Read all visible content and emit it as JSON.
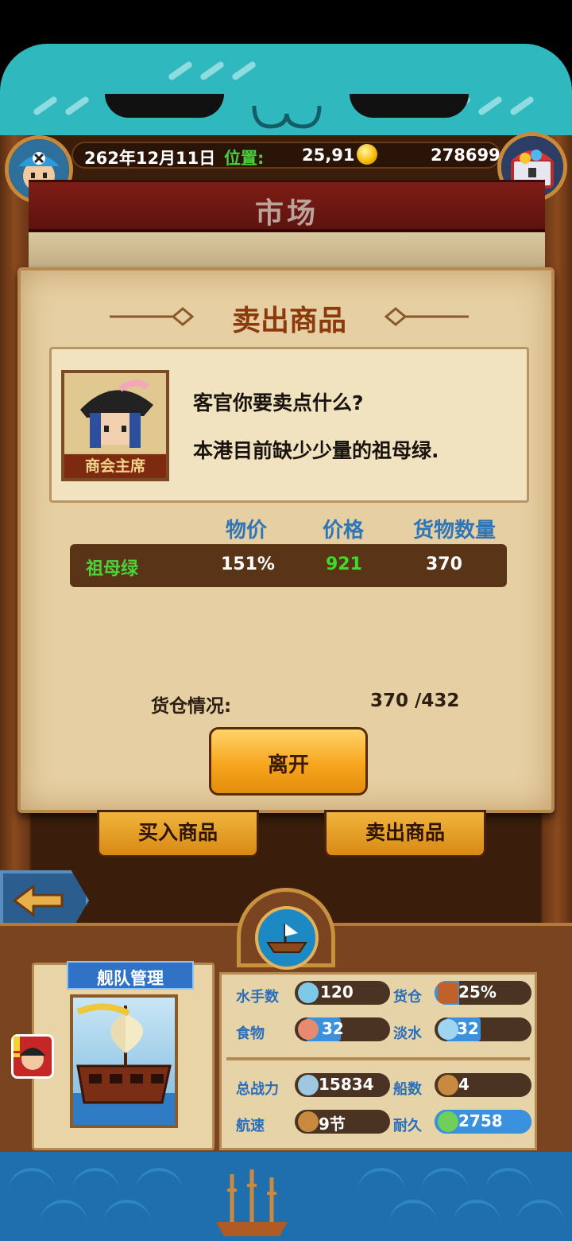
{
  "status": {
    "date": "262年12月11日",
    "position_label": "位置:",
    "position_value": "25,91",
    "gold": "278699"
  },
  "market": {
    "title": "市场"
  },
  "sell_panel": {
    "title": "卖出商品",
    "npc_label": "商会主席",
    "dialog_line1": "客官你要卖点什么?",
    "dialog_line2": "本港目前缺少少量的祖母绿.",
    "columns": [
      "物价",
      "价格",
      "货物数量"
    ],
    "goods": [
      {
        "name": "祖母绿",
        "price_index": "151%",
        "price": "921",
        "quantity": "370"
      }
    ],
    "hold_label": "货仓情况:",
    "hold_value": "370 /432",
    "leave_label": "离开"
  },
  "bottom_buttons": {
    "buy": "买入商品",
    "sell": "卖出商品"
  },
  "fleet": {
    "title": "舰队管理",
    "stats": [
      {
        "label": "水手数",
        "value": "120",
        "icon": "sailor-icon"
      },
      {
        "label": "货仓",
        "value": "25%",
        "icon": "cargo-icon",
        "fill": 0.25
      },
      {
        "label": "食物",
        "value": "32",
        "icon": "meat-icon"
      },
      {
        "label": "淡水",
        "value": "32",
        "icon": "water-icon"
      },
      {
        "label": "总战力",
        "value": "15834",
        "icon": "swords-icon"
      },
      {
        "label": "船数",
        "value": "4",
        "icon": "ship-count-icon"
      },
      {
        "label": "航速",
        "value": "9节",
        "icon": "speed-icon"
      },
      {
        "label": "耐久",
        "value": "2758",
        "icon": "durability-icon",
        "fill": 1.0
      }
    ]
  },
  "colors": {
    "teal": "#2fb8bd",
    "parchment": "#e6cfa2",
    "title_brown": "#8b3a0e",
    "header_blue": "#2f76b9",
    "price_green": "#3ddc2a",
    "goods_name_green": "#4cd23a"
  }
}
